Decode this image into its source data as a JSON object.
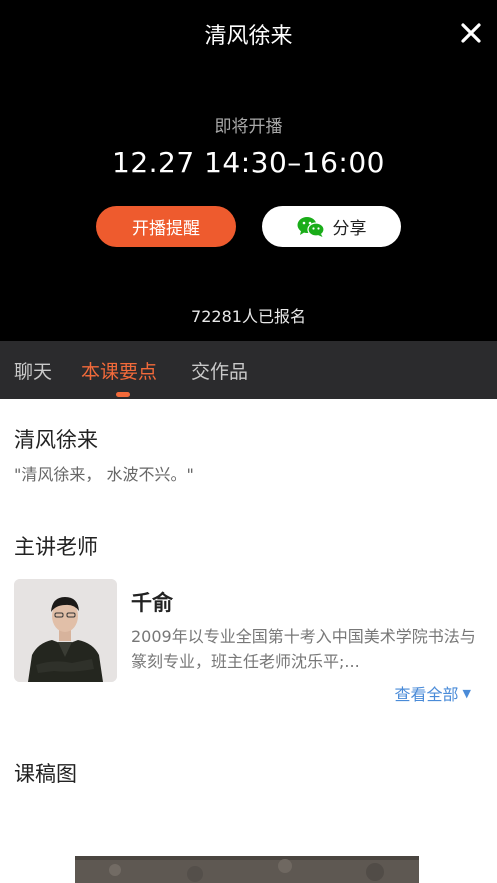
{
  "live": {
    "title": "清风徐来",
    "status": "即将开播",
    "time": "12.27 14:30–16:00",
    "remind_label": "开播提醒",
    "share_label": "分享",
    "signup_count": "72281人已报名"
  },
  "tabs": [
    {
      "label": "聊天"
    },
    {
      "label": "本课要点"
    },
    {
      "label": "交作品"
    }
  ],
  "course": {
    "title": "清风徐来",
    "quote": "\"清风徐来， 水波不兴。\""
  },
  "teacher_section": {
    "title": "主讲老师",
    "name": "千俞",
    "bio": "2009年以专业全国第十考入中国美术学院书法与篆刻专业，班主任老师沈乐平;...",
    "view_all_label": "查看全部"
  },
  "slides_section": {
    "title": "课稿图"
  },
  "colors": {
    "accent": "#f26a3a",
    "remind_button": "#ee5b2e",
    "link": "#4a8bd8",
    "wechat_green": "#1aad19"
  },
  "icons": {
    "close": "close-icon",
    "share": "wechat-icon",
    "view_all": "caret-down-icon"
  }
}
